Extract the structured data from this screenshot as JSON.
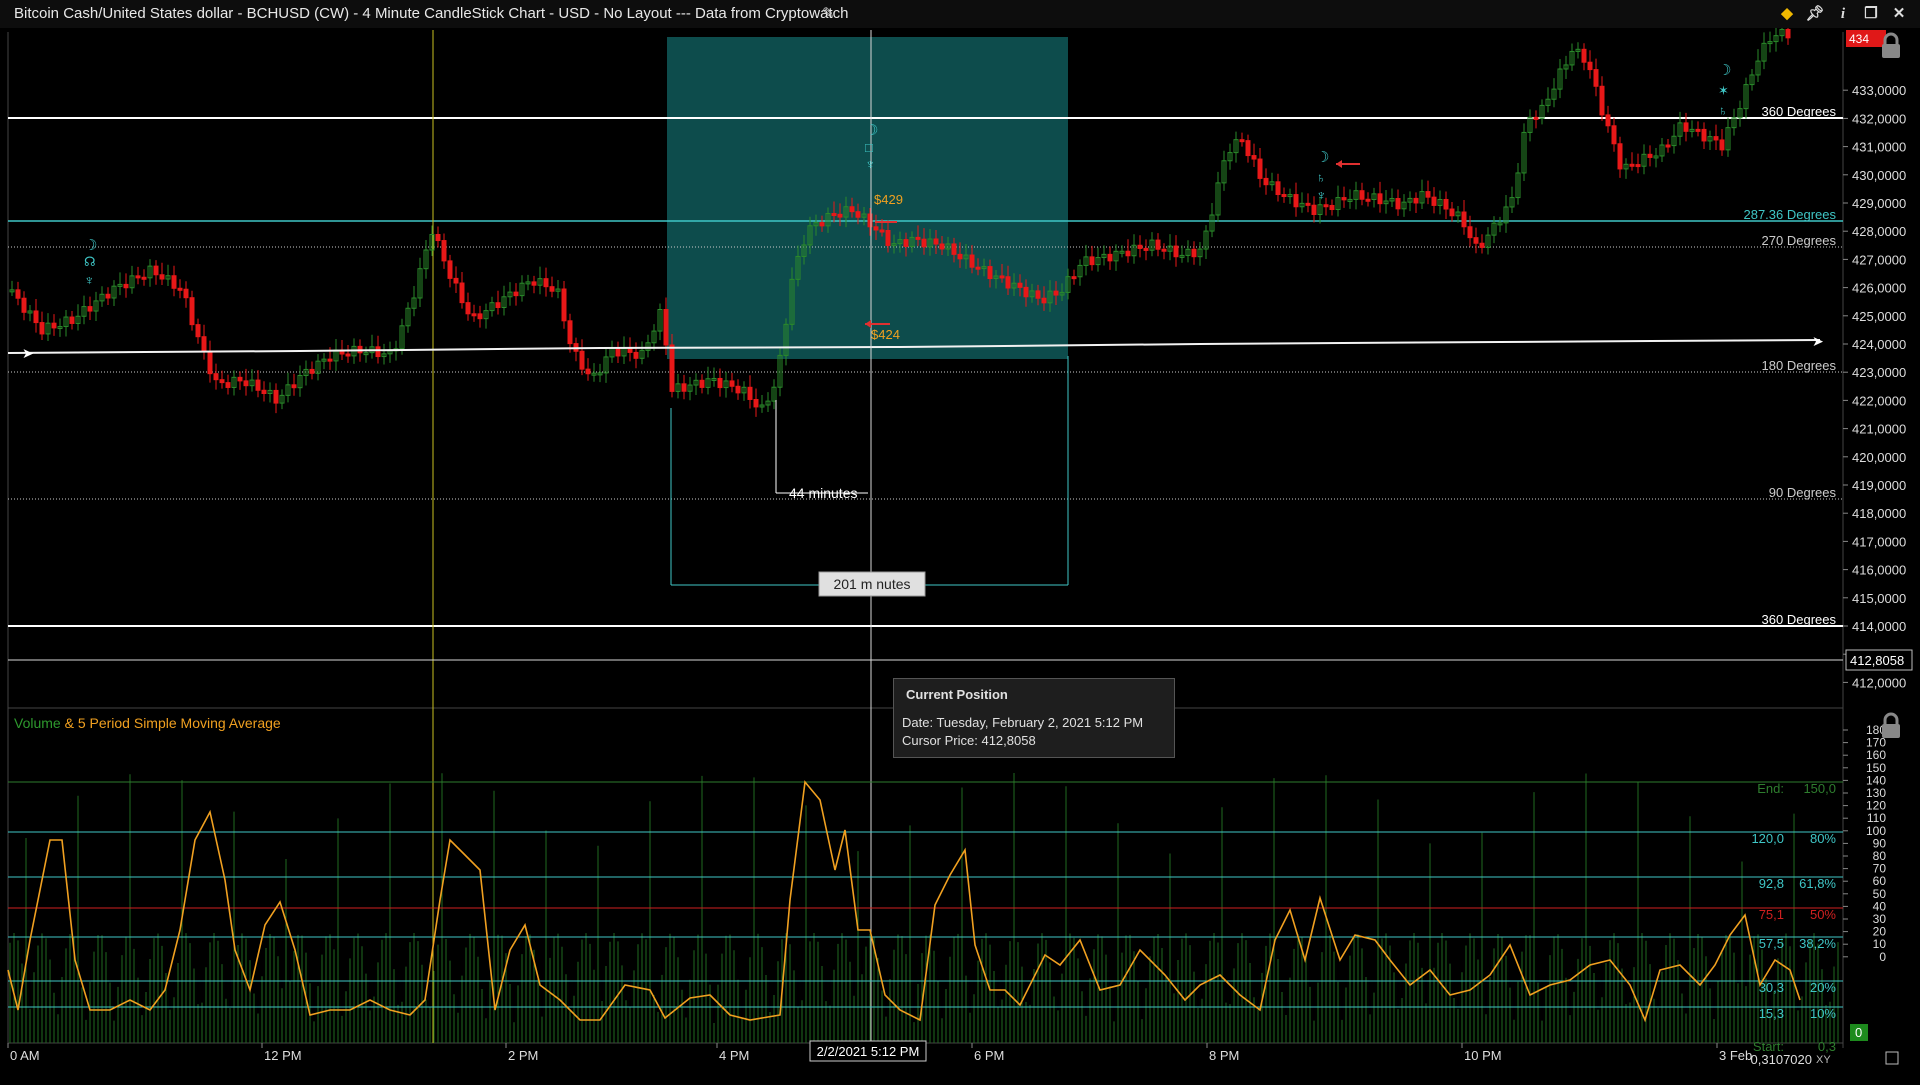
{
  "window": {
    "title": "Bitcoin Cash/United States dollar - BCHUSD (CW) - 4 Minute CandleStick Chart - USD - No Layout --- Data from Cryptowatch",
    "edit_icon": "pencil-icon",
    "buttons": [
      "diamond-icon",
      "pin-icon",
      "info-icon",
      "restore-icon",
      "close-icon"
    ]
  },
  "price_axis": {
    "labels": [
      "434,0000",
      "433,0000",
      "432,0000",
      "431,0000",
      "430,0000",
      "429,0000",
      "428,0000",
      "427,0000",
      "426,0000",
      "425,0000",
      "424,0000",
      "423,0000",
      "422,0000",
      "421,0000",
      "420,0000",
      "419,0000",
      "418,0000",
      "417,0000",
      "416,0000",
      "415,0000",
      "414,0000",
      "413,0000",
      "412,0000"
    ],
    "current_price": "434",
    "cursor_price": "412,8058"
  },
  "degree_lines": [
    {
      "label": "360 Degrees",
      "color": "#ffffff"
    },
    {
      "label": "287.36 Degrees",
      "color": "#3fc6c6"
    },
    {
      "label": "270 Degrees",
      "color": "#cccccc"
    },
    {
      "label": "180 Degrees",
      "color": "#cccccc"
    },
    {
      "label": "90 Degrees",
      "color": "#cccccc"
    },
    {
      "label": "360 Degrees",
      "color": "#ffffff"
    }
  ],
  "annotations": {
    "high_price": "$429",
    "low_price": "$424",
    "span_short": "44 minutes",
    "span_long": "201 m nutes"
  },
  "indicator": {
    "title_volume": "Volume",
    "title_rest": " & 5 Period Simple Moving Average",
    "axis_labels": [
      "180",
      "170",
      "160",
      "150",
      "140",
      "130",
      "120",
      "110",
      "100",
      "90",
      "80",
      "70",
      "60",
      "50",
      "40",
      "30",
      "20",
      "10",
      "0"
    ],
    "fib_levels": [
      {
        "value": "End:",
        "pct": "150,0",
        "color": "#2e7d2e"
      },
      {
        "value": "120,0",
        "pct": "80%",
        "color": "#3fc6c6"
      },
      {
        "value": "92,8",
        "pct": "61,8%",
        "color": "#3fc6c6"
      },
      {
        "value": "75,1",
        "pct": "50%",
        "color": "#d02020"
      },
      {
        "value": "57,5",
        "pct": "38,2%",
        "color": "#3fc6c6"
      },
      {
        "value": "30,3",
        "pct": "20%",
        "color": "#3fc6c6"
      },
      {
        "value": "15,3",
        "pct": "10%",
        "color": "#3fc6c6"
      },
      {
        "value": "Start:",
        "pct": "0,3",
        "color": "#2e7d2e"
      }
    ],
    "current_value": "0",
    "sma_color": "#f0a020",
    "volume_color": "#1f6a1f"
  },
  "time_axis": {
    "labels": [
      "0 AM",
      "12 PM",
      "2 PM",
      "4 PM",
      "6 PM",
      "8 PM",
      "10 PM",
      "3 Feb"
    ],
    "cursor_time": "2/2/2021 5:12 PM",
    "bottom_value": "0,3107020",
    "xy_label": "XY"
  },
  "tooltip": {
    "title": "Current Position",
    "date": "Date: Tuesday, February 2, 2021 5:12 PM",
    "price": "Cursor Price: 412,8058"
  },
  "colors": {
    "up": "#2a8a2a",
    "down": "#e81818",
    "box_fill": "#0e5050",
    "measure": "#3fc6c6"
  }
}
